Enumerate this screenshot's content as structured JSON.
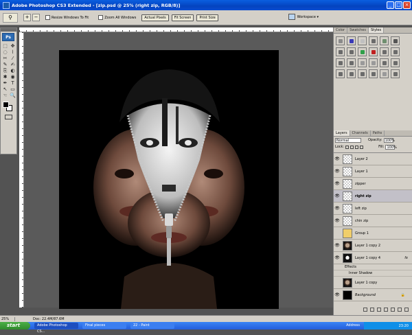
{
  "window": {
    "title": "Adobe Photoshop CS3 Extended - [zip.psd @ 25% (right zip, RGB/8)]",
    "buttons": [
      "_",
      "□",
      "×"
    ]
  },
  "options_bar": {
    "tool_icon": "zoom-icon",
    "checkbox1": "Resize Windows To Fit",
    "checkbox2": "Zoom All Windows",
    "btn_actual": "Actual Pixels",
    "btn_fit": "Fit Screen",
    "btn_print": "Print Size",
    "workspace": "Workspace ▾"
  },
  "toolbox": {
    "logo": "Ps",
    "tools": [
      "⬚",
      "✥",
      "◌",
      "⌇",
      "✂",
      "⁄",
      "✎",
      "✍",
      "⎘",
      "◐",
      "✱",
      "◉",
      "✒",
      "T",
      "↖",
      "▭",
      "☜",
      "🔍"
    ]
  },
  "status": {
    "zoom": "25%",
    "doc": "Doc: 22.4M/87.6M"
  },
  "styles_panel": {
    "tabs": [
      "Color",
      "Swatches",
      "Styles"
    ],
    "active_tab": "Styles",
    "swatches": [
      "#8a8a8a",
      "#3a3ab8",
      "#c0c0c0",
      "#6b6b6b",
      "#6f8f6f",
      "#555555",
      "#6a6a6a",
      "#6a6a6a",
      "#2fa04a",
      "#c02020",
      "#6b6b6b",
      "#6b6b6b",
      "#6b6b6b",
      "#6b6b6b",
      "#9a9a9a",
      "#9a9a9a",
      "#6b6b6b",
      "#6b6b6b",
      "#6b6b6b",
      "#6b6b6b",
      "#6b6b6b",
      "#6b6b6b",
      "#9a9a9a",
      "#6b6b6b"
    ]
  },
  "layers_panel": {
    "tabs": [
      "Layers",
      "Channels",
      "Paths"
    ],
    "active_tab": "Layers",
    "blend": "Normal",
    "opacity_label": "Opacity:",
    "opacity": "100%",
    "lock_label": "Lock:",
    "fill_label": "Fill:",
    "fill": "100%",
    "effects_label": "Effects",
    "inner_shadow": "Inner Shadow",
    "layers": [
      {
        "name": "Layer 2",
        "thumb": "trans"
      },
      {
        "name": "Layer 1",
        "thumb": "trans"
      },
      {
        "name": "zipper",
        "thumb": "trans"
      },
      {
        "name": "right zip",
        "thumb": "trans"
      },
      {
        "name": "left zip",
        "thumb": "trans"
      },
      {
        "name": "chin zip",
        "thumb": "trans"
      },
      {
        "name": "Group 1",
        "thumb": "folder"
      },
      {
        "name": "Layer 1 copy 2",
        "thumb": "face"
      },
      {
        "name": "Layer 1 copy 4",
        "thumb": "mask",
        "fx": "fx"
      },
      {
        "name": "Layer 1 copy",
        "thumb": "face"
      },
      {
        "name": "Background",
        "thumb": "dark"
      }
    ]
  },
  "taskbar": {
    "start": "start",
    "tasks": [
      "Adobe Photoshop CS...",
      "Final pieces",
      "22 - Paint"
    ],
    "address": "Address",
    "time": "23:20"
  }
}
